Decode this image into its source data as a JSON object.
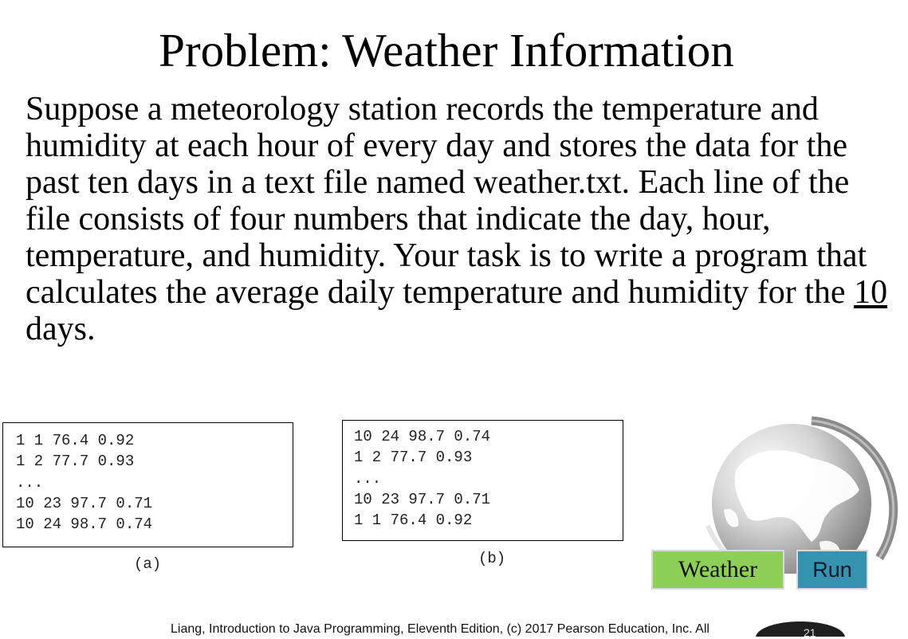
{
  "slide": {
    "title": "Problem: Weather Information",
    "body_before": "Suppose a meteorology station records the temperature and humidity at each hour of every day and stores the data for the past ten days in a text file named weather.txt. Each line of the file consists of four numbers that indicate the day, hour, temperature, and humidity. Your task is to write a program that calculates the average daily temperature and humidity for the ",
    "body_underlined": "10",
    "body_after": " days."
  },
  "box_a": {
    "lines": [
      "1 1 76.4 0.92",
      "1 2 77.7 0.93",
      "...",
      "10 23 97.7 0.71",
      "10 24 98.7 0.74"
    ],
    "caption": "(a)"
  },
  "box_b": {
    "lines": [
      "10 24 98.7 0.74",
      "1 2 77.7 0.93",
      "...",
      "10 23 97.7 0.71",
      "1 1 76.4 0.92"
    ],
    "caption": "(b)"
  },
  "buttons": {
    "weather_label": "Weather",
    "run_label": "Run"
  },
  "footer": {
    "text": "Liang, Introduction to Java Programming, Eleventh Edition, (c) 2017 Pearson Education, Inc. All",
    "page_number": "21"
  },
  "icons": {
    "decoration": "globe-icon"
  },
  "colors": {
    "weather_button": "#8ed057",
    "run_button": "#3593b0"
  }
}
